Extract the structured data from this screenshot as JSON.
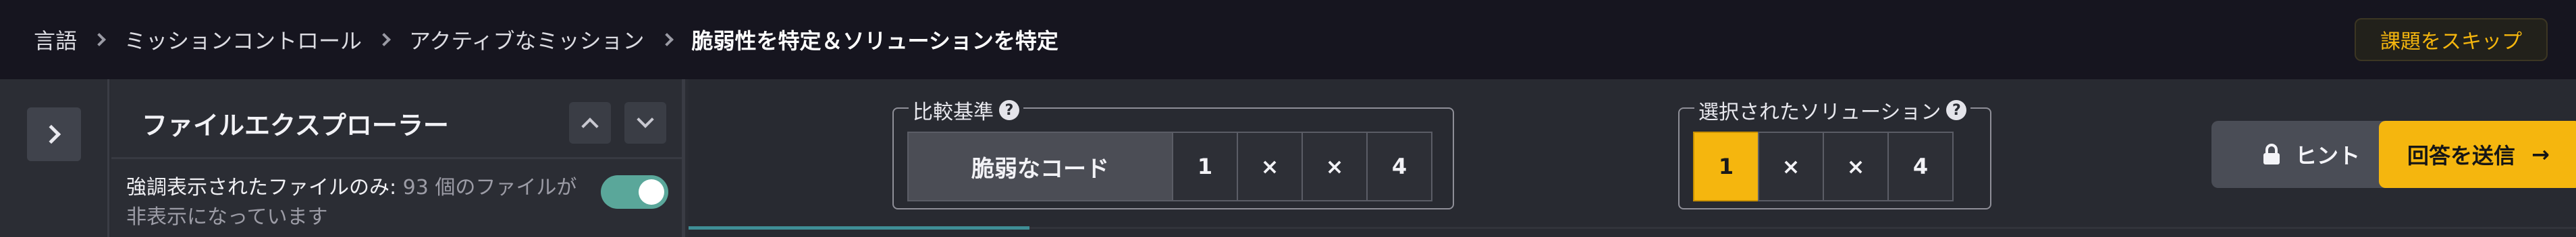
{
  "breadcrumb": {
    "items": [
      "言語",
      "ミッションコントロール",
      "アクティブなミッション"
    ],
    "current": "脆弱性を特定＆ソリューションを特定"
  },
  "header": {
    "skip_label": "課題をスキップ"
  },
  "explorer": {
    "title": "ファイルエクスプローラー",
    "filter_highlight": "強調表示されたファイルのみ:",
    "filter_rest": "93 個のファイルが非表示になっています",
    "toggle_on": true
  },
  "baseline": {
    "label": "比較基準",
    "help": "?",
    "chips": [
      "脆弱なコード",
      "1",
      "×",
      "×",
      "4"
    ]
  },
  "selected": {
    "label": "選択されたソリューション",
    "help": "?",
    "chips": [
      "1",
      "×",
      "×",
      "4"
    ]
  },
  "actions": {
    "hint_label": "ヒント",
    "submit_label": "回答を送信",
    "submit_arrow": "→"
  },
  "colors": {
    "accent": "#f5b60e",
    "toggle": "#5aa79a",
    "topbar": "#16151f"
  },
  "icons": [
    "chevron-right-icon",
    "chevron-up-icon",
    "chevron-down-icon",
    "help-icon",
    "lock-icon",
    "arrow-right-icon"
  ]
}
